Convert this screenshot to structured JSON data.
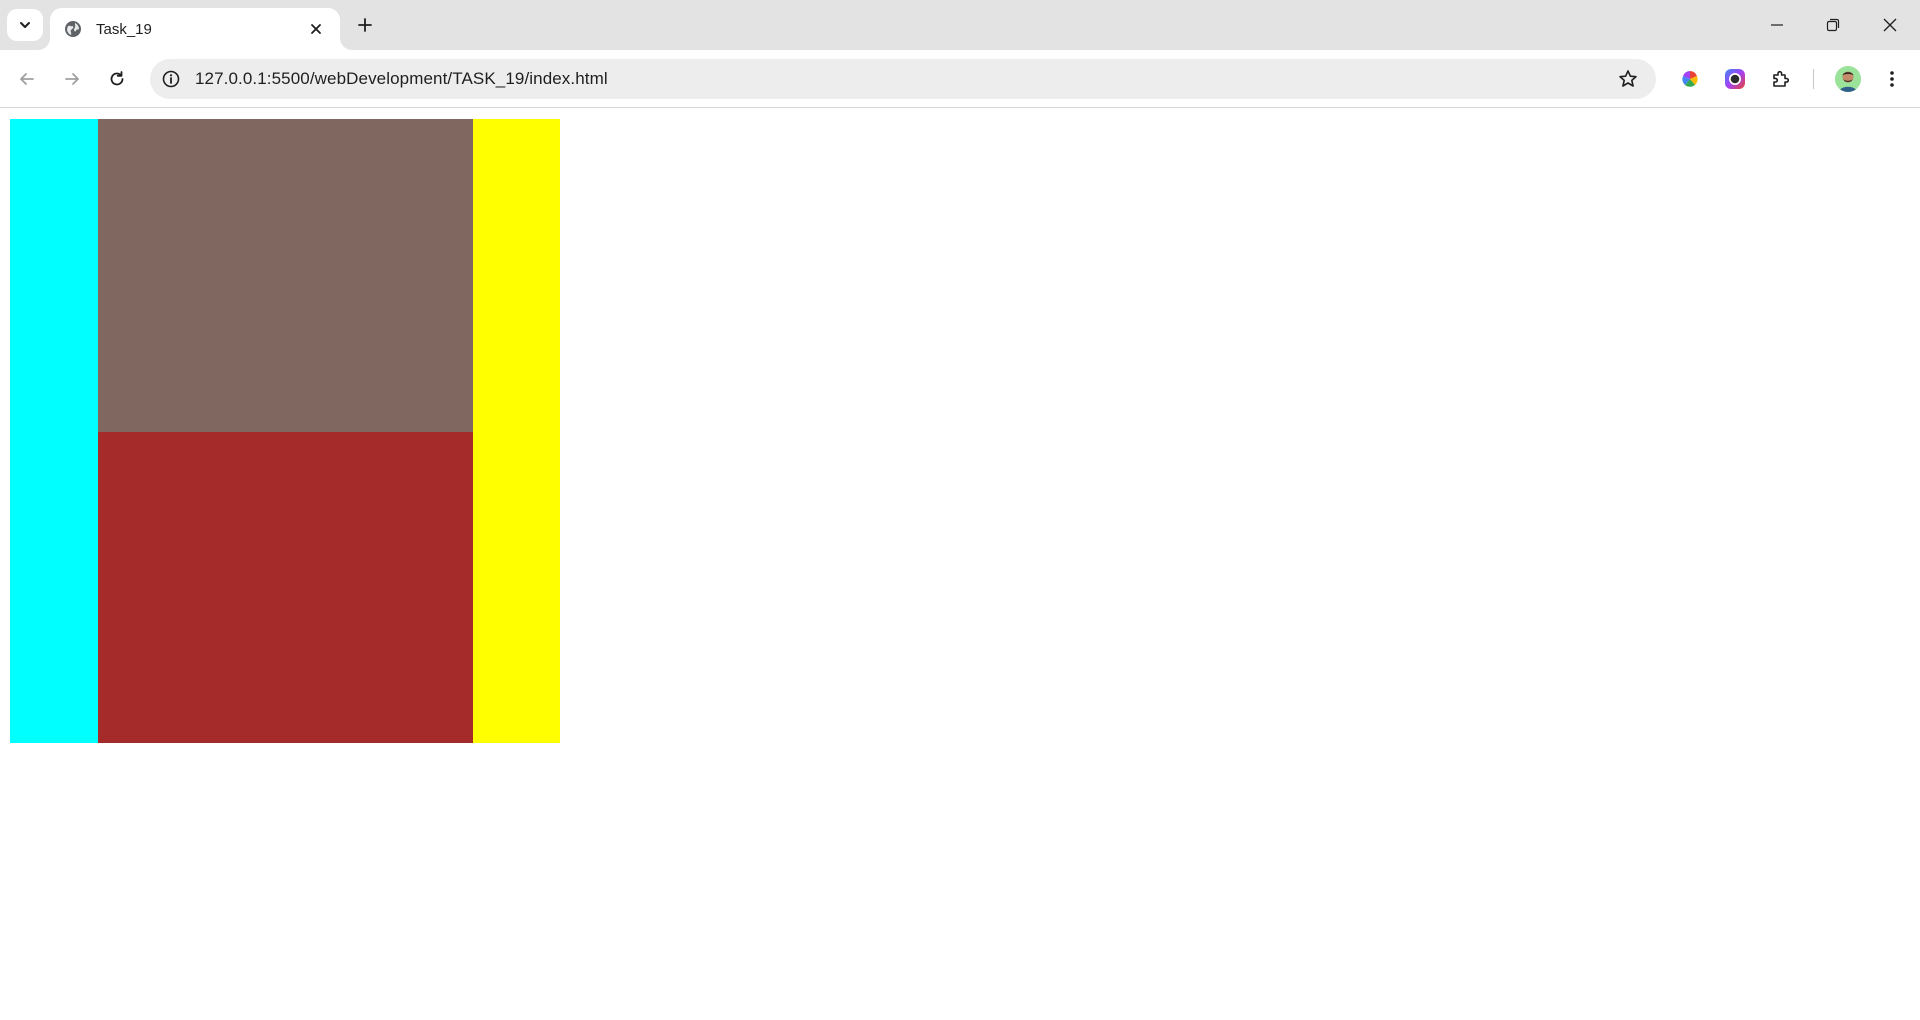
{
  "browser": {
    "tab": {
      "title": "Task_19",
      "favicon": "globe-icon"
    },
    "address_bar": {
      "url": "127.0.0.1:5500/webDevelopment/TASK_19/index.html"
    },
    "icons": {
      "tab_search": "chevron-down-icon",
      "tab_close": "close-icon",
      "new_tab": "plus-icon",
      "minimize": "minimize-icon",
      "restore": "restore-icon",
      "close_window": "close-icon",
      "back": "arrow-left-icon",
      "forward": "arrow-right-icon",
      "reload": "reload-icon",
      "site_info": "info-icon",
      "bookmark": "star-icon",
      "extension_1": "color-wheel-icon",
      "extension_2": "circle-lens-icon",
      "extensions_menu": "puzzle-icon",
      "profile": "avatar",
      "menu": "more-vertical-icon"
    }
  },
  "page": {
    "blocks": [
      {
        "name": "left-column",
        "color": "#00ffff"
      },
      {
        "name": "middle-top",
        "color": "#80675f"
      },
      {
        "name": "middle-bottom",
        "color": "#a52a2a"
      },
      {
        "name": "right-column",
        "color": "#ffff00"
      }
    ]
  }
}
